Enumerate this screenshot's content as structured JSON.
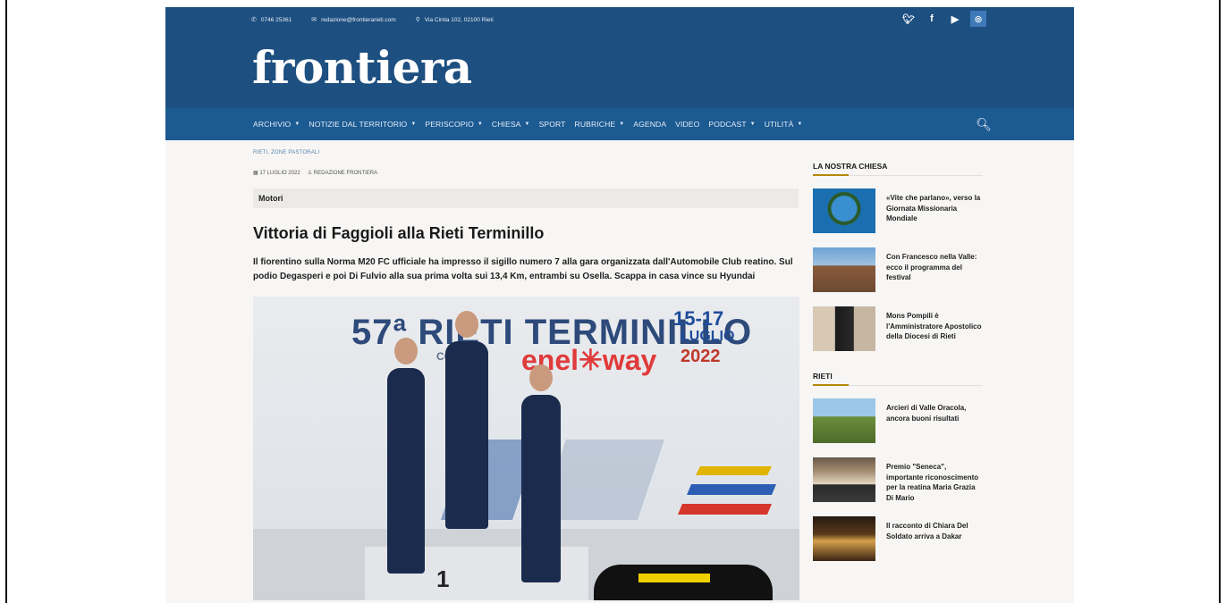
{
  "topbar": {
    "phone": "0746 25361",
    "email": "redazione@frontierarieti.com",
    "address": "Via Cintia 102, 02100 Rieti",
    "social": [
      "twitter-icon",
      "facebook-icon",
      "youtube-icon",
      "instagram-icon"
    ]
  },
  "brand": {
    "logo": "frontiera",
    "color": "#1d4f80"
  },
  "nav": {
    "items": [
      {
        "label": "ARCHIVIO",
        "dropdown": true
      },
      {
        "label": "NOTIZIE DAL TERRITORIO",
        "dropdown": true
      },
      {
        "label": "PERISCOPIO",
        "dropdown": true
      },
      {
        "label": "CHIESA",
        "dropdown": true
      },
      {
        "label": "SPORT",
        "dropdown": false
      },
      {
        "label": "RUBRICHE",
        "dropdown": true
      },
      {
        "label": "AGENDA",
        "dropdown": false
      },
      {
        "label": "VIDEO",
        "dropdown": false
      },
      {
        "label": "PODCAST",
        "dropdown": true
      },
      {
        "label": "UTILITÀ",
        "dropdown": true
      }
    ]
  },
  "article": {
    "breadcrumb": "RIETI, ZONE PASTORALI",
    "date": "17 LUGLIO 2022",
    "author": "REDAZIONE FRONTIERA",
    "category": "Motori",
    "title": "Vittoria di Faggioli alla Rieti Terminillo",
    "lead": "Il fiorentino sulla Norma M20 FC ufficiale ha impresso il sigillo numero 7 alla gara organizzata dall'Automobile Club reatino. Sul podio Degasperi e poi Di Fulvio alla sua prima volta sui 13,4 Km, entrambi su Osella. Scappa in casa vince su Hyundai",
    "hero": {
      "banner_title": "57ª RIETI TERMINILLO",
      "banner_dates": "15-17",
      "banner_month": "LUGLIO",
      "banner_year": "2022",
      "banner_sponsor": "enel✳way",
      "banner_coppa": "COPPA",
      "podium_number": "1"
    }
  },
  "sidebar": {
    "section1": {
      "title": "LA NOSTRA CHIESA",
      "items": [
        {
          "text": "«Vite che parlano», verso la Giornata Missionaria Mondiale"
        },
        {
          "text": "Con Francesco nella Valle: ecco il programma del festival"
        },
        {
          "text": "Mons Pompili è l'Amministratore Apostolico della Diocesi di Rieti"
        }
      ]
    },
    "section2": {
      "title": "RIETI",
      "items": [
        {
          "text": "Arcieri di Valle Oracola, ancora buoni risultati"
        },
        {
          "text": "Premio \"Seneca\", importante riconoscimento per la reatina Maria Grazia Di Mario"
        },
        {
          "text": "Il racconto di Chiara Del Soldato arriva a Dakar"
        }
      ]
    }
  }
}
